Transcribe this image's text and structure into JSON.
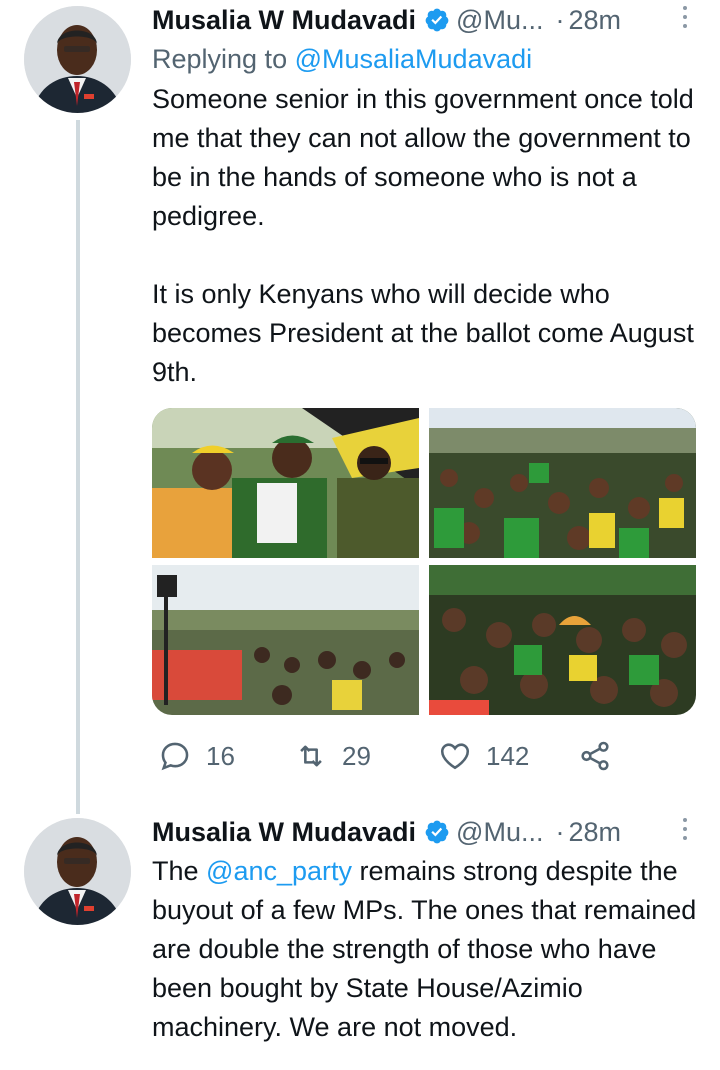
{
  "tweets": [
    {
      "author_name": "Musalia W Mudavadi",
      "handle": "@Mu...",
      "separator": "·",
      "time": "28m",
      "replying_label": "Replying to",
      "replying_handle": "@MusaliaMudavadi",
      "text": "Someone senior in this government once told me that they can not allow the government to be in the hands of someone who is not a pedigree.\n\nIt is only Kenyans who will decide who becomes President at the ballot come August 9th.",
      "replies": "16",
      "retweets": "29",
      "likes": "142"
    },
    {
      "author_name": "Musalia W Mudavadi",
      "handle": "@Mu...",
      "separator": "·",
      "time": "28m",
      "text_before": "The ",
      "mention": "@anc_party",
      "text_after": " remains strong despite the buyout of a few MPs. The ones that remained are double the strength of those who have been bought by State House/Azimio machinery. We are not moved."
    }
  ],
  "icons": {
    "verified": "verified-badge-icon",
    "more": "more-vertical-icon",
    "reply": "reply-icon",
    "retweet": "retweet-icon",
    "like": "heart-icon",
    "share": "share-icon"
  },
  "colors": {
    "link": "#1d9bf0",
    "secondary": "#536471",
    "thread_line": "#cfd9de"
  }
}
